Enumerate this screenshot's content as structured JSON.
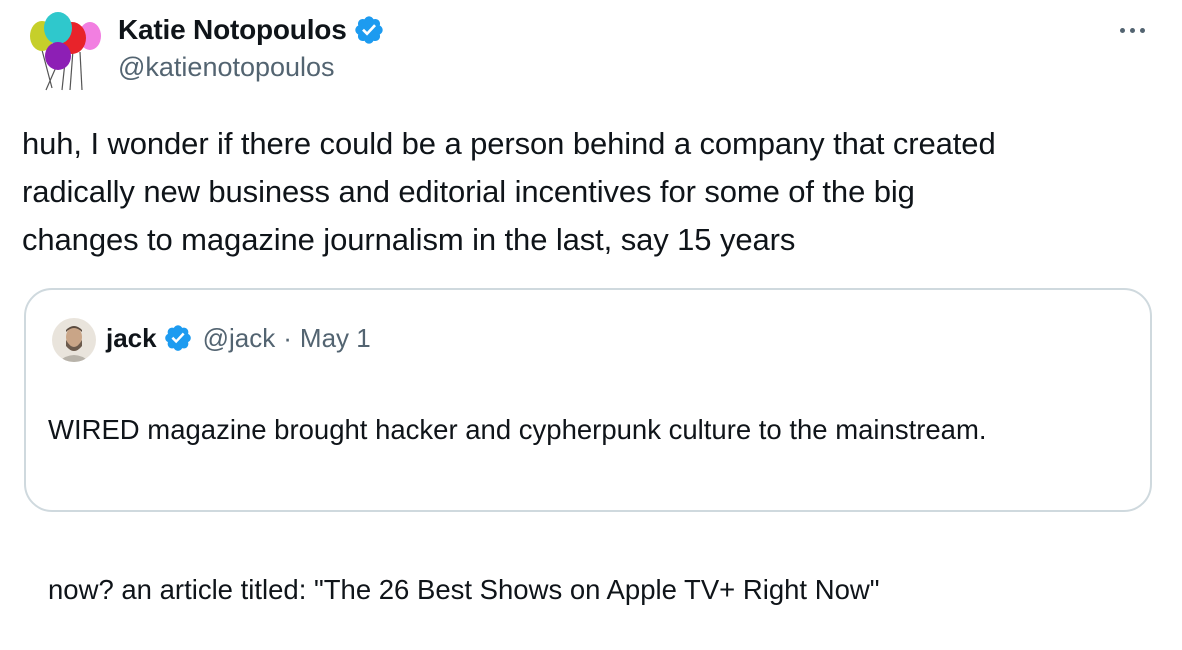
{
  "author": {
    "display_name": "Katie Notopoulos",
    "handle": "@katienotopoulos",
    "avatar_icon": "balloons-avatar-icon",
    "verified_icon": "verified-badge-icon",
    "verified_color": "#1d9bf0"
  },
  "more_icon": "more-dots-icon",
  "tweet": {
    "line1": "huh, I wonder if there could be a person behind a company that created",
    "line2": "radically new business and editorial incentives for some of the big",
    "line3": "changes to magazine journalism in the last, say 15 years"
  },
  "quoted": {
    "display_name": "jack",
    "handle": "@jack",
    "separator": "·",
    "date": "May 1",
    "avatar_icon": "jack-avatar-icon",
    "text_line1": "WIRED magazine brought hacker and cypherpunk culture to the mainstream.",
    "text_line2": "now? an article titled: \"The 26 Best Shows on Apple TV+ Right Now\""
  },
  "colors": {
    "text": "#0f1419",
    "secondary": "#536471",
    "border": "#cfd9de"
  }
}
